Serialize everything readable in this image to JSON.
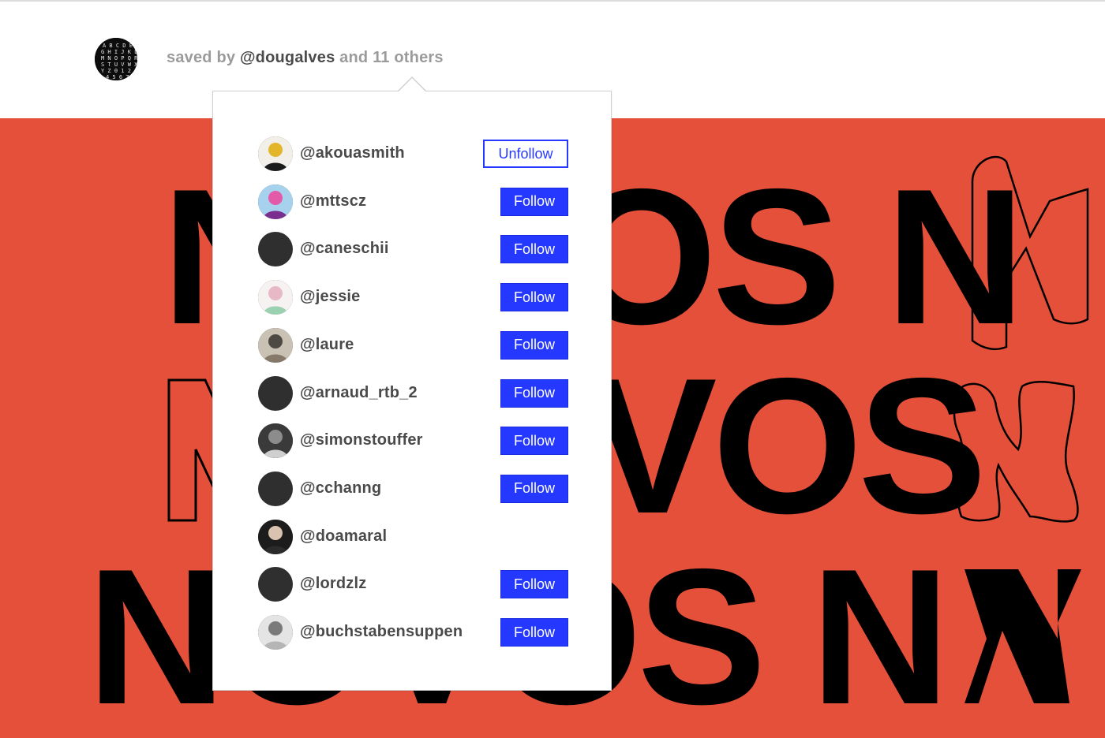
{
  "header": {
    "saved_prefix": "saved by",
    "saved_user": "@dougalves",
    "saved_suffix": "and 11 others",
    "avatar_icon": "alphabet-poster-avatar"
  },
  "banner": {
    "background_color": "#e5503a",
    "text_rows": [
      "NOVOS N",
      "NOVOS N",
      "NOVOS N"
    ]
  },
  "popover": {
    "users": [
      {
        "handle": "@akouasmith",
        "action": "Unfollow",
        "avatar": "photo"
      },
      {
        "handle": "@mttscz",
        "action": "Follow",
        "avatar": "photo"
      },
      {
        "handle": "@caneschii",
        "action": "Follow",
        "avatar": "default"
      },
      {
        "handle": "@jessie",
        "action": "Follow",
        "avatar": "photo"
      },
      {
        "handle": "@laure",
        "action": "Follow",
        "avatar": "photo"
      },
      {
        "handle": "@arnaud_rtb_2",
        "action": "Follow",
        "avatar": "default"
      },
      {
        "handle": "@simonstouffer",
        "action": "Follow",
        "avatar": "photo"
      },
      {
        "handle": "@cchanng",
        "action": "Follow",
        "avatar": "default"
      },
      {
        "handle": "@doamaral",
        "action": "",
        "avatar": "photo"
      },
      {
        "handle": "@lordzlz",
        "action": "Follow",
        "avatar": "default"
      },
      {
        "handle": "@buchstabensuppen",
        "action": "Follow",
        "avatar": "photo"
      }
    ]
  },
  "colors": {
    "accent": "#2538ff",
    "banner": "#e5503a",
    "muted_text": "#9b9b9b",
    "strong_text": "#4a4a4a"
  }
}
